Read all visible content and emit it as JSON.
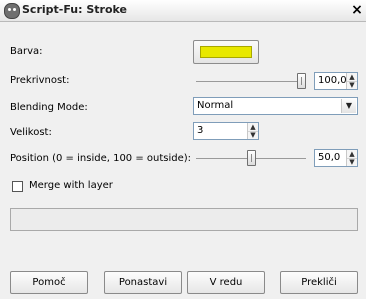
{
  "window": {
    "title": "Script-Fu: Stroke",
    "close_label": "×"
  },
  "colors": {
    "swatch": "#e8e800",
    "accent_border": "#7f9db9"
  },
  "fields": {
    "barva": {
      "label": "Barva:"
    },
    "prekrivnost": {
      "label": "Prekrivnost:",
      "value": "100,0",
      "slider_fraction": 1.0
    },
    "blending": {
      "label": "Blending Mode:",
      "value": "Normal"
    },
    "velikost": {
      "label": "Velikost:",
      "value": "3"
    },
    "position": {
      "label": "Position (0 = inside, 100 = outside):",
      "value": "50,0",
      "slider_fraction": 0.5
    },
    "merge": {
      "label": "Merge with layer",
      "checked": false
    }
  },
  "buttons": {
    "help": "Pomoč",
    "reset": "Ponastavi",
    "ok": "V redu",
    "cancel": "Prekliči"
  }
}
